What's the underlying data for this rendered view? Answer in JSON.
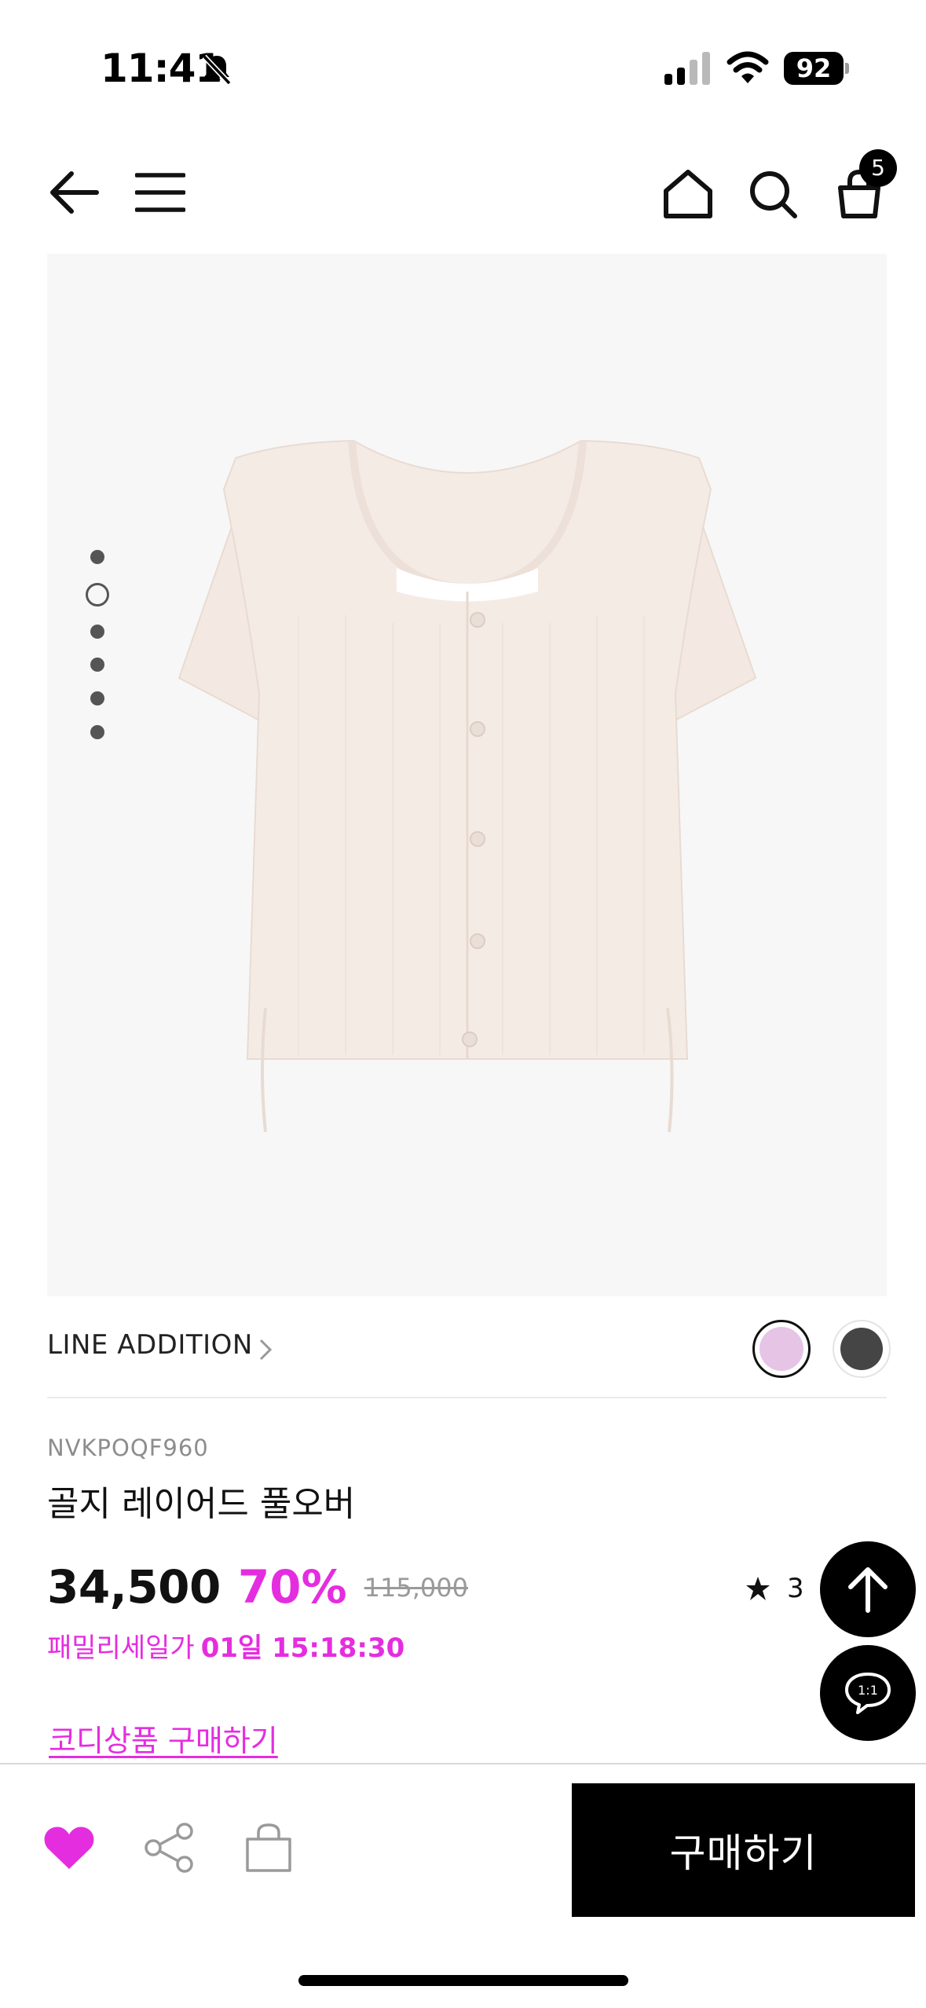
{
  "status_bar": {
    "time": "11:41",
    "battery": "92"
  },
  "header": {
    "cart_count": "5"
  },
  "carousel": {
    "dot_count": 6,
    "active_index": 1
  },
  "product": {
    "brand": "LINE ADDITION",
    "code": "NVKPOQF960",
    "title": "골지 레이어드 풀오버",
    "price": "34,500",
    "discount": "70%",
    "original_price": "115,000",
    "rating": "3",
    "sale_label": "패밀리세일가",
    "sale_countdown": "01일 15:18:30",
    "codi_link": "코디상품 구매하기",
    "colors": [
      "#e5c4e6",
      "#454545"
    ]
  },
  "bottom_bar": {
    "buy_label": "구매하기"
  },
  "theme": {
    "accent": "#e52de0",
    "dark": "#000000"
  },
  "icons": [
    "bell-slash-icon",
    "signal-icon",
    "wifi-icon",
    "back-arrow-icon",
    "menu-icon",
    "home-icon",
    "search-icon",
    "cart-icon",
    "chevron-right-icon",
    "star-icon",
    "arrow-up-icon",
    "chat-icon",
    "heart-icon",
    "share-icon",
    "shopping-bag-icon"
  ]
}
